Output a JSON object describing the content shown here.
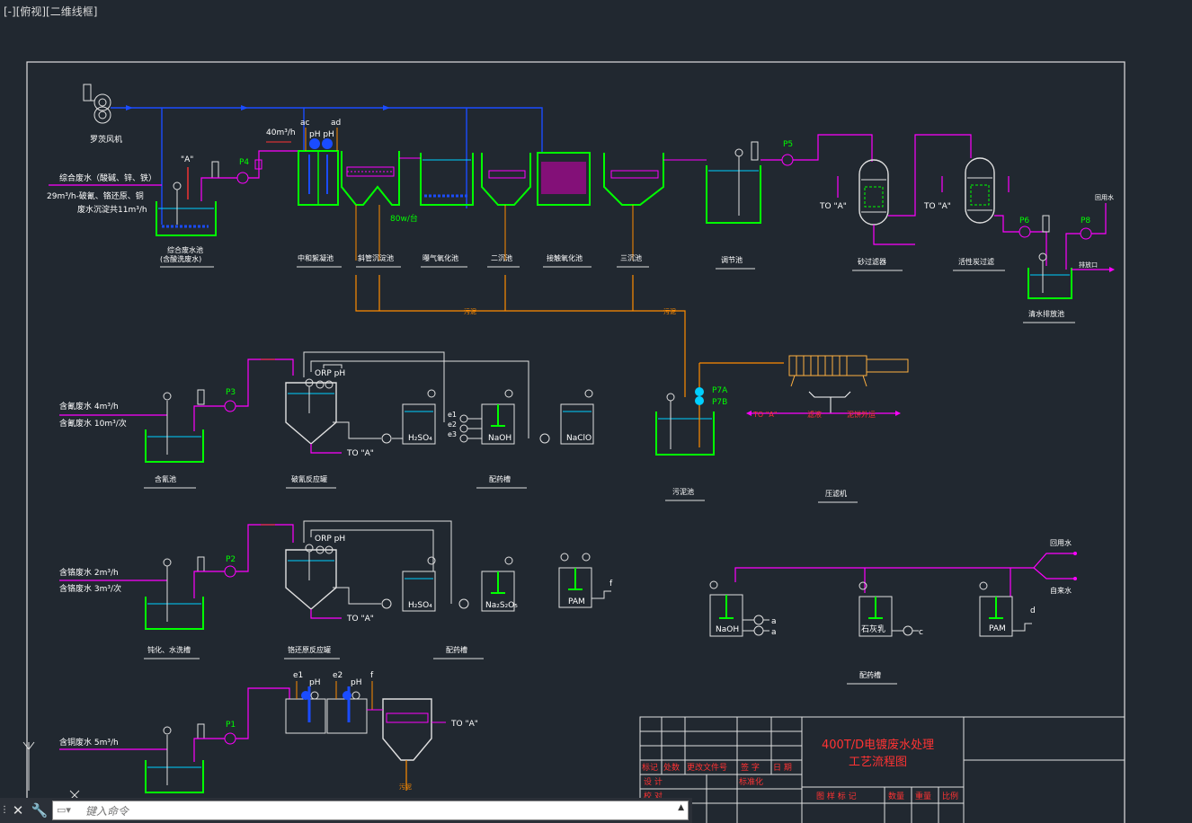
{
  "viewport": {
    "label": "[-][俯视][二维线框]"
  },
  "command": {
    "placeholder": "键入命令"
  },
  "colors": {
    "background": "#212830",
    "water": "#ff00ff",
    "air": "#1a4cff",
    "sludge": "#ff8c00",
    "tank": "#00ff00",
    "frame": "#e0e0e0",
    "text": "#ffffff",
    "title": "#ff3333"
  },
  "top_row": {
    "blower_label": "罗茨风机",
    "inlet_lines": [
      "综合废水（酸碱、锌、铁）",
      "29m³/h-破氰、铬还原、铜",
      "废水沉淀共11m³/h"
    ],
    "flow_label": "40m³/h",
    "p4": "P4",
    "p5": "P5",
    "p6": "P6",
    "p8": "P8",
    "to_a_1": "TO \"A\"",
    "to_a_2": "TO \"A\"",
    "dose_ac": "ac",
    "dose_ad": "ad",
    "dose_ph": "pH pH",
    "motor_label": "80w/台",
    "reuse_water": "回用水",
    "discharge": "排放口",
    "tanks": [
      "综合废水池",
      "(含酸洗废水)",
      "中和絮凝池",
      "斜管沉淀池",
      "曝气氧化池",
      "二沉池",
      "接触氧化池",
      "三沉池",
      "调节池",
      "砂过滤器",
      "活性炭过滤",
      "清水排放池"
    ],
    "sludge_labels": [
      "污泥",
      "污泥"
    ]
  },
  "sludge": {
    "tank": "污泥池",
    "press": "压滤机",
    "p7a": "P7A",
    "p7b": "P7B",
    "to_a": "TO \"A\"",
    "filtrate": "滤液",
    "cake": "泥饼外运"
  },
  "cyanide": {
    "inlet_1": "含氰废水 4m³/h",
    "inlet_2": "含氰废水 10m³/次",
    "pump": "P3",
    "orp": "ORP pH",
    "to_a": "TO \"A\"",
    "tank": "含氰池",
    "reactor": "破氰反应罐",
    "dosing": "配药槽",
    "chem_1": "H₂SO₄",
    "chem_2": "NaOH",
    "chem_3": "NaClO",
    "e_labels": [
      "e1",
      "e2",
      "e3"
    ]
  },
  "chrome": {
    "inlet_1": "含铬废水 2m³/h",
    "inlet_2": "含铬废水 3m³/次",
    "pump": "P2",
    "orp": "ORP pH",
    "to_a": "TO \"A\"",
    "tank": "钝化、水洗槽",
    "reactor": "铬还原反应罐",
    "dosing": "配药槽",
    "chem_1": "H₂SO₄",
    "chem_2": "Na₂S₂O₅",
    "chem_3": "PAM",
    "chem_3_tag": "f"
  },
  "copper": {
    "inlet_1": "含铜废水 5m³/h",
    "pump": "P1",
    "e1": "e1",
    "e2": "e2",
    "f": "f",
    "ph1": "pH",
    "ph2": "pH",
    "to_a": "TO \"A\"",
    "sludge": "污泥"
  },
  "dosing_right": {
    "reuse": "回用水",
    "tap": "自来水",
    "chem_1": "NaOH",
    "chem_2": "石灰乳",
    "chem_3": "PAM",
    "tag_a": "a",
    "tag_b": "a",
    "tag_c": "c",
    "tag_d": "d",
    "label": "配药槽"
  },
  "title_block": {
    "title_1": "400T/D电镀废水处理",
    "title_2": "工艺流程图",
    "row_1": [
      "标记",
      "处数",
      "更改文件号",
      "签 字",
      "日 期"
    ],
    "design": "设 计",
    "standard": "标准化",
    "check": "校 对",
    "cols": [
      "图 样 标 记",
      "数量",
      "重量",
      "比例"
    ]
  }
}
